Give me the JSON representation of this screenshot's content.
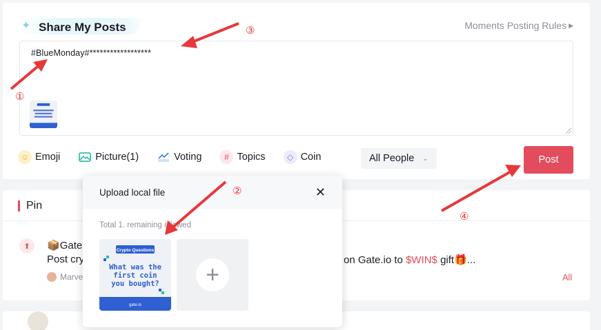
{
  "share": {
    "title": "Share My Posts",
    "rules_link": "Moments Posting Rules",
    "post_text": "#BlueMonday#******************"
  },
  "toolbar": {
    "emoji": "Emoji",
    "picture": "Picture(1)",
    "voting": "Voting",
    "topics": "Topics",
    "coin": "Coin",
    "audience": "All People",
    "post": "Post"
  },
  "pin": {
    "title": "Pin",
    "user": "Gate.",
    "text_left": "Post cry",
    "text_right_pre": "on Gate.io to ",
    "text_right_highlight": "$WIN$",
    "text_right_post": " gift",
    "ellipsis": "...",
    "author": "Marve",
    "all_link": "All"
  },
  "upload": {
    "title": "Upload local file",
    "count_text": "Total 1. remaining allowed",
    "image_header": "Crypto Questions",
    "image_text_1": "What was the",
    "image_text_2": "first coin",
    "image_text_3": "you bought?",
    "image_brand": "gate.io"
  },
  "annotations": [
    "①",
    "②",
    "③",
    "④"
  ],
  "colors": {
    "accent": "#e24c5c",
    "arrow": "#e8373c",
    "image_bg": "#eef1f5",
    "image_band": "#2f5fd0"
  },
  "icons": {
    "emoji": "smiley-icon",
    "picture": "image-icon",
    "voting": "chart-icon",
    "topics": "hash-icon",
    "coin": "diamond-icon"
  }
}
